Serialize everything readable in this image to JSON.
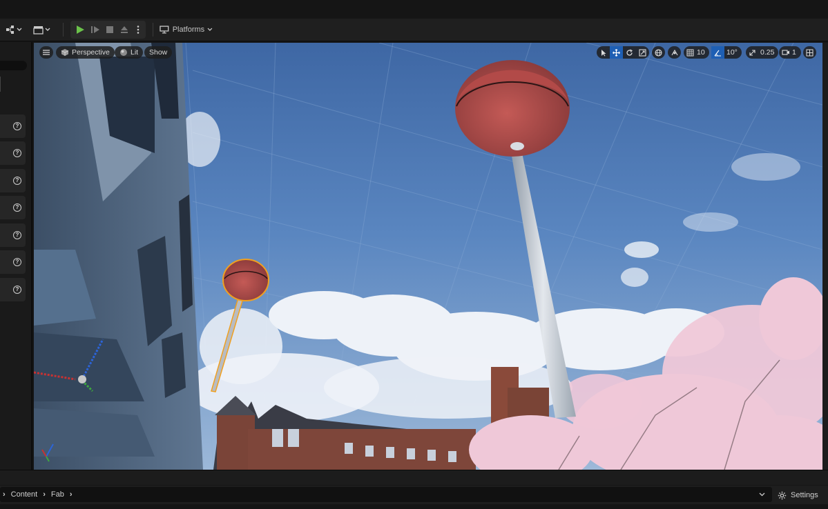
{
  "toolbar": {
    "platforms_label": "Platforms",
    "play_color": "#6bc24a"
  },
  "left_panel": {
    "row_count": 7,
    "help_glyph": "?"
  },
  "viewport": {
    "view_mode_label": "Perspective",
    "lighting_label": "Lit",
    "show_label": "Show",
    "grid_snap_value": "10",
    "rotation_snap_value": "10°",
    "scale_snap_value": "0.25",
    "camera_speed_value": "1",
    "sky_color": "#4a73ad"
  },
  "content_browser": {
    "breadcrumbs": [
      "Content",
      "Fab"
    ],
    "settings_label": "Settings"
  }
}
